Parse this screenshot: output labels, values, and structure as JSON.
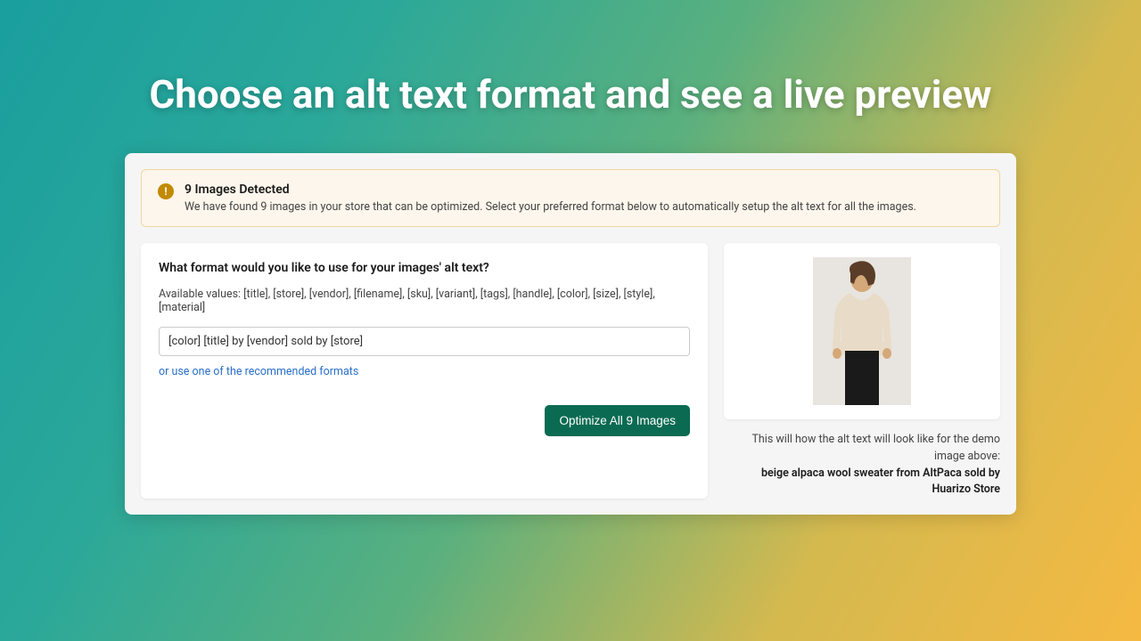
{
  "title": "Choose an alt text format and see a live preview",
  "banner": {
    "heading": "9 Images Detected",
    "description": "We have found 9 images in your store that can be optimized. Select your preferred format below to automatically setup the alt text for all the images."
  },
  "form": {
    "question": "What format would you like to use for your images' alt text?",
    "available_label": "Available values: [title], [store], [vendor], [filename], [sku], [variant], [tags], [handle], [color], [size], [style], [material]",
    "input_value": "[color] [title] by [vendor] sold by [store]",
    "recommended_link": "or use one of the recommended formats",
    "button": "Optimize All 9 Images"
  },
  "preview": {
    "caption_prefix": "This will how the alt text will look like for the demo image above:",
    "caption_result": "beige alpaca wool sweater from AltPaca sold by Huarizo Store"
  }
}
